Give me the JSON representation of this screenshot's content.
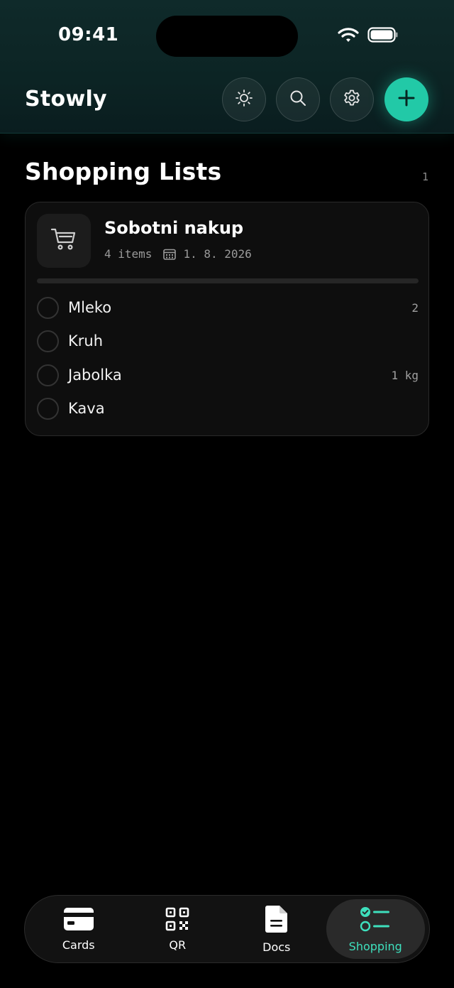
{
  "status": {
    "time": "09:41"
  },
  "header": {
    "title": "Stowly",
    "accent": "#22c9a7"
  },
  "section": {
    "title": "Shopping Lists",
    "count": "1"
  },
  "list": {
    "name": "Sobotni nakup",
    "items_count": "4 items",
    "date": "1. 8. 2026",
    "progress": 0,
    "items": [
      {
        "label": "Mleko",
        "qty": "2"
      },
      {
        "label": "Kruh",
        "qty": ""
      },
      {
        "label": "Jabolka",
        "qty": "1 kg"
      },
      {
        "label": "Kava",
        "qty": ""
      }
    ]
  },
  "tabs": [
    {
      "label": "Cards",
      "icon": "card-icon"
    },
    {
      "label": "QR",
      "icon": "qr-icon"
    },
    {
      "label": "Docs",
      "icon": "document-icon"
    },
    {
      "label": "Shopping",
      "icon": "checklist-icon",
      "active": true
    }
  ]
}
